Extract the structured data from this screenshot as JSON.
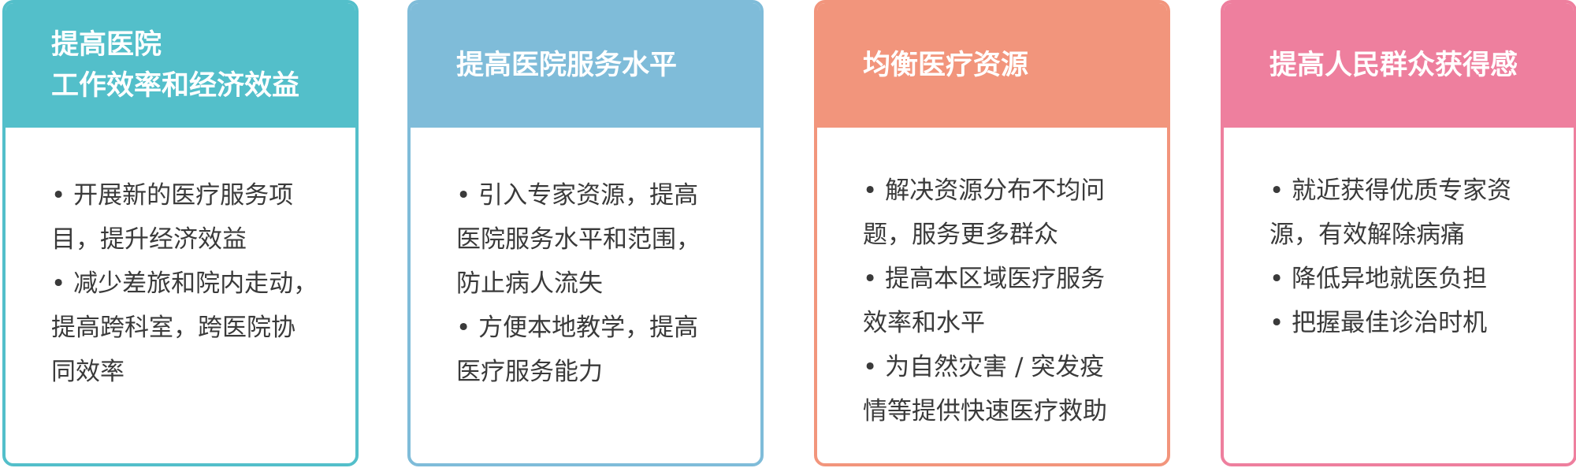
{
  "cards": [
    {
      "color": "#53bfca",
      "title_lines": [
        "提高医院",
        "工作效率和经济效益"
      ],
      "body_lines": [
        {
          "kind": "bullet",
          "text": "• 开展新的医疗服务项"
        },
        {
          "kind": "cont",
          "text": "目，提升经济效益"
        },
        {
          "kind": "bullet",
          "text": "• 减少差旅和院内走动，"
        },
        {
          "kind": "cont",
          "text": "提高跨科室，跨医院协"
        },
        {
          "kind": "cont",
          "text": "同效率"
        }
      ]
    },
    {
      "color": "#7fbcd9",
      "title_lines": [
        "提高医院服务水平"
      ],
      "body_lines": [
        {
          "kind": "bullet",
          "text": "• 引入专家资源，提高"
        },
        {
          "kind": "cont",
          "text": "医院服务水平和范围，"
        },
        {
          "kind": "cont",
          "text": "防止病人流失"
        },
        {
          "kind": "bullet",
          "text": "• 方便本地教学，提高"
        },
        {
          "kind": "cont",
          "text": "医疗服务能力"
        }
      ]
    },
    {
      "color": "#f2957c",
      "title_lines": [
        "均衡医疗资源"
      ],
      "body_lines": [
        {
          "kind": "bullet",
          "text": "• 解决资源分布不均问"
        },
        {
          "kind": "cont",
          "text": "题，服务更多群众"
        },
        {
          "kind": "bullet",
          "text": "• 提高本区域医疗服务"
        },
        {
          "kind": "cont",
          "text": "效率和水平"
        },
        {
          "kind": "bullet",
          "text": "• 为自然灾害 / 突发疫"
        },
        {
          "kind": "cont",
          "text": "情等提供快速医疗救助"
        }
      ]
    },
    {
      "color": "#ee7f9e",
      "title_lines": [
        "提高人民群众获得感"
      ],
      "body_lines": [
        {
          "kind": "bullet",
          "text": "• 就近获得优质专家资"
        },
        {
          "kind": "cont",
          "text": "源，有效解除病痛"
        },
        {
          "kind": "bullet",
          "text": "• 降低异地就医负担"
        },
        {
          "kind": "bullet",
          "text": "• 把握最佳诊治时机"
        }
      ]
    }
  ]
}
